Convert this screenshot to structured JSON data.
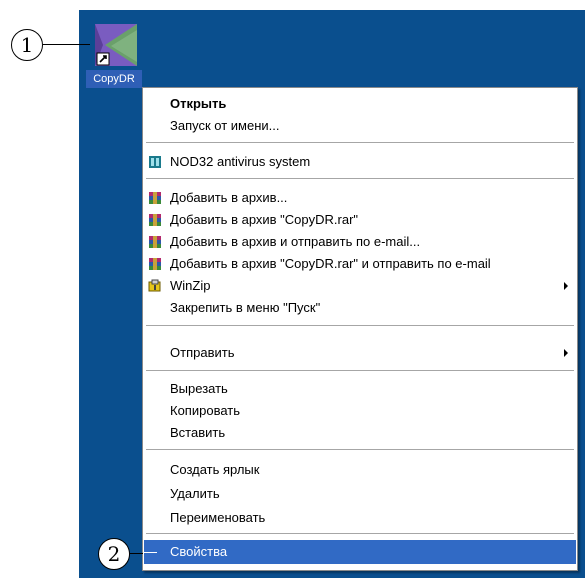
{
  "desktop": {
    "background_color": "#0a4f8e",
    "icon": {
      "name": "copydr-app-icon",
      "label": "CopyDR"
    }
  },
  "callouts": [
    {
      "number": "1"
    },
    {
      "number": "2"
    }
  ],
  "context_menu": {
    "highlight_color": "#316ac5",
    "items": [
      {
        "label": "Открыть",
        "bold": true
      },
      {
        "label": "Запуск от имени..."
      },
      {
        "label": "NOD32 antivirus system",
        "icon": "nod32-icon"
      },
      {
        "label": "Добавить в архив...",
        "icon": "winrar-icon"
      },
      {
        "label": "Добавить в архив \"CopyDR.rar\"",
        "icon": "winrar-icon"
      },
      {
        "label": "Добавить в архив и отправить по e-mail...",
        "icon": "winrar-icon"
      },
      {
        "label": "Добавить в архив \"CopyDR.rar\" и отправить по e-mail",
        "icon": "winrar-icon"
      },
      {
        "label": "WinZip",
        "icon": "winzip-icon",
        "submenu": true
      },
      {
        "label": "Закрепить в меню \"Пуск\""
      },
      {
        "label": "Отправить",
        "submenu": true
      },
      {
        "label": "Вырезать"
      },
      {
        "label": "Копировать"
      },
      {
        "label": "Вставить"
      },
      {
        "label": "Создать ярлык"
      },
      {
        "label": "Удалить"
      },
      {
        "label": "Переименовать"
      },
      {
        "label": "Свойства",
        "highlighted": true
      }
    ]
  }
}
